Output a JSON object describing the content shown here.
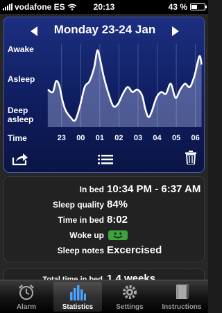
{
  "status": {
    "carrier": "vodafone ES",
    "time": "20:13",
    "battery": "43 %",
    "battery_level": 0.43
  },
  "header": {
    "date": "Monday 23-24 Jan"
  },
  "chart": {
    "y_labels": [
      "Awake",
      "Asleep",
      "Deep\nasleep"
    ],
    "x_title": "Time",
    "x_ticks": [
      "23",
      "00",
      "01",
      "02",
      "03",
      "04",
      "05",
      "06"
    ]
  },
  "details": {
    "in_bed_label": "In bed",
    "in_bed_value": "10:34 PM - 6:37 AM",
    "quality_label": "Sleep quality",
    "quality_value": "84%",
    "time_label": "Time in bed",
    "time_value": "8:02",
    "wokeup_label": "Woke up",
    "wokeup_mood": "happy",
    "notes_label": "Sleep notes",
    "notes_value": "Excercised"
  },
  "totals": {
    "label": "Total time in bed",
    "value": "1.4 weeks"
  },
  "tabs": [
    {
      "label": "Alarm",
      "icon": "alarm-clock-icon",
      "active": false
    },
    {
      "label": "Statistics",
      "icon": "statistics-icon",
      "active": true
    },
    {
      "label": "Settings",
      "icon": "gear-icon",
      "active": false
    },
    {
      "label": "Instructions",
      "icon": "book-icon",
      "active": false
    }
  ],
  "colors": {
    "chart_bg": "#14236b",
    "mood_green": "#3ca23c"
  },
  "chart_data": {
    "type": "area",
    "x": [
      "22:34",
      "22:50",
      "23:00",
      "23:10",
      "23:20",
      "23:30",
      "23:45",
      "00:00",
      "00:15",
      "00:30",
      "00:45",
      "01:00",
      "01:10",
      "01:20",
      "01:30",
      "01:45",
      "02:00",
      "02:15",
      "02:30",
      "02:45",
      "03:00",
      "03:15",
      "03:30",
      "03:40",
      "03:50",
      "04:00",
      "04:15",
      "04:30",
      "04:45",
      "05:00",
      "05:15",
      "05:30",
      "05:45",
      "06:00",
      "06:15",
      "06:30",
      "06:37"
    ],
    "values": [
      0.45,
      0.42,
      0.55,
      0.5,
      0.32,
      0.2,
      0.12,
      0.08,
      0.25,
      0.48,
      0.55,
      0.72,
      0.92,
      0.78,
      0.6,
      0.4,
      0.25,
      0.28,
      0.4,
      0.48,
      0.42,
      0.45,
      0.38,
      0.22,
      0.12,
      0.18,
      0.35,
      0.42,
      0.4,
      0.52,
      0.35,
      0.45,
      0.52,
      0.48,
      0.62,
      0.85,
      0.75
    ],
    "x_ticks": [
      "23",
      "00",
      "01",
      "02",
      "03",
      "04",
      "05",
      "06"
    ],
    "ylim": [
      0,
      1
    ],
    "y_labels": [
      "Deep asleep",
      "Asleep",
      "Awake"
    ],
    "grid": true
  }
}
